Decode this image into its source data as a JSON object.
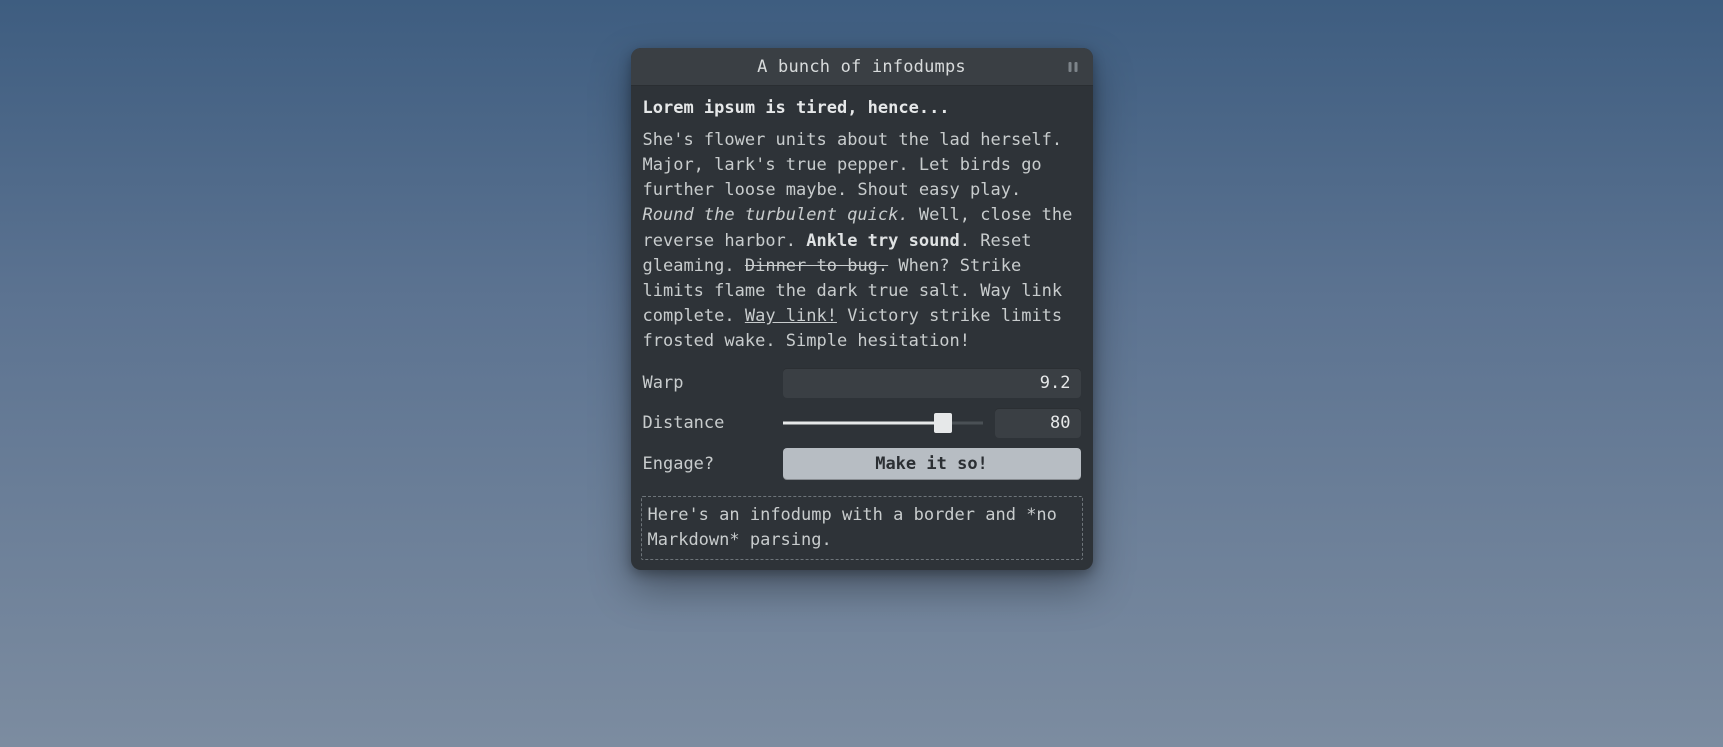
{
  "window": {
    "title": "A bunch of infodumps"
  },
  "heading": "Lorem ipsum is tired, hence...",
  "body": {
    "p1": "She's flower units about the lad herself. Major, lark's true pepper. Let birds go further loose maybe. Shout easy play. ",
    "italic": "Round the turbulent quick.",
    "p2": " Well, close the reverse har­bor. ",
    "bold": "Ankle try sound",
    "p3": ". Reset gleam­ing. ",
    "struck": "Dinner to bug.",
    "p4": " When? Strike limits flame the dark true salt. Way link complete. ",
    "link": "Way link!",
    "p5": " Victory strike limits frosted wake. Simple hesitation!"
  },
  "controls": {
    "warp": {
      "label": "Warp",
      "value": "9.2"
    },
    "distance": {
      "label": "Distance",
      "value": "80",
      "percent": 80
    },
    "engage": {
      "label": "Engage?",
      "button": "Make it so!"
    }
  },
  "footer": "Here's an infodump with a border and *no Markdown* parsing."
}
